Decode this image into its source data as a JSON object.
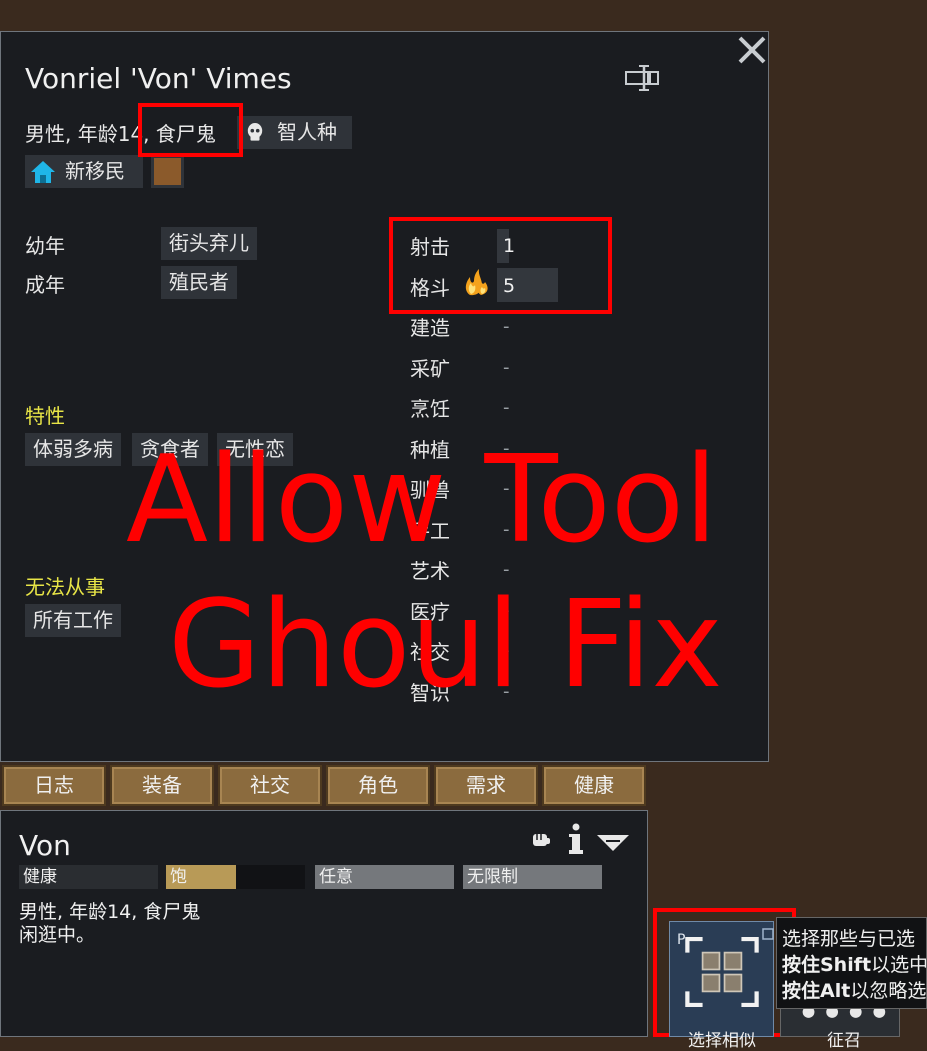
{
  "colonist": {
    "full_name": "Vonriel 'Von' Vimes",
    "description_prefix": "男性, 年龄14",
    "description_xenotype": ", 食尸鬼",
    "race": "智人种",
    "faction": "新移民"
  },
  "backstory": {
    "childhood_label": "幼年",
    "childhood_value": "街头弃儿",
    "adulthood_label": "成年",
    "adulthood_value": "殖民者"
  },
  "traits": {
    "heading": "特性",
    "items": [
      "体弱多病",
      "贪食者",
      "无性恋"
    ]
  },
  "incapable": {
    "heading": "无法从事",
    "items": [
      "所有工作"
    ]
  },
  "skills": [
    {
      "name": "射击",
      "value": "1"
    },
    {
      "name": "格斗",
      "value": "5"
    },
    {
      "name": "建造",
      "value": "-"
    },
    {
      "name": "采矿",
      "value": "-"
    },
    {
      "name": "烹饪",
      "value": "-"
    },
    {
      "name": "种植",
      "value": "-"
    },
    {
      "name": "驯兽",
      "value": "-"
    },
    {
      "name": "手工",
      "value": "-"
    },
    {
      "name": "艺术",
      "value": "-"
    },
    {
      "name": "医疗",
      "value": "-"
    },
    {
      "name": "社交",
      "value": "-"
    },
    {
      "name": "智识",
      "value": "-"
    }
  ],
  "overlay_text": {
    "line1": "Allow Tool",
    "line2": "Ghoul Fix"
  },
  "tabs": [
    "日志",
    "装备",
    "社交",
    "角色",
    "需求",
    "健康"
  ],
  "inspect": {
    "name": "Von",
    "bars": {
      "health": "健康",
      "food": "饱",
      "food_level": 0.5,
      "mood": "任意",
      "restriction": "无限制"
    },
    "line1": "男性, 年龄14, 食尸鬼",
    "line2": "闲逛中。"
  },
  "gizmo": {
    "hotkey": "P",
    "label": "选择相似",
    "second_label": "征召"
  },
  "tooltip": {
    "line1": "选择那些与已选",
    "line2_bold": "按住Shift",
    "line2_rest": "以选中",
    "line3_bold": "按住Alt",
    "line3_rest": "以忽略选"
  },
  "colors": {
    "panel_bg": "#1a1c20",
    "chip_bg": "#2f3339",
    "heading_yellow": "#e8e547",
    "tab_brown": "#8b6b3e",
    "annotation_red": "#ff0000",
    "faction_color": "#8b5a2b"
  }
}
